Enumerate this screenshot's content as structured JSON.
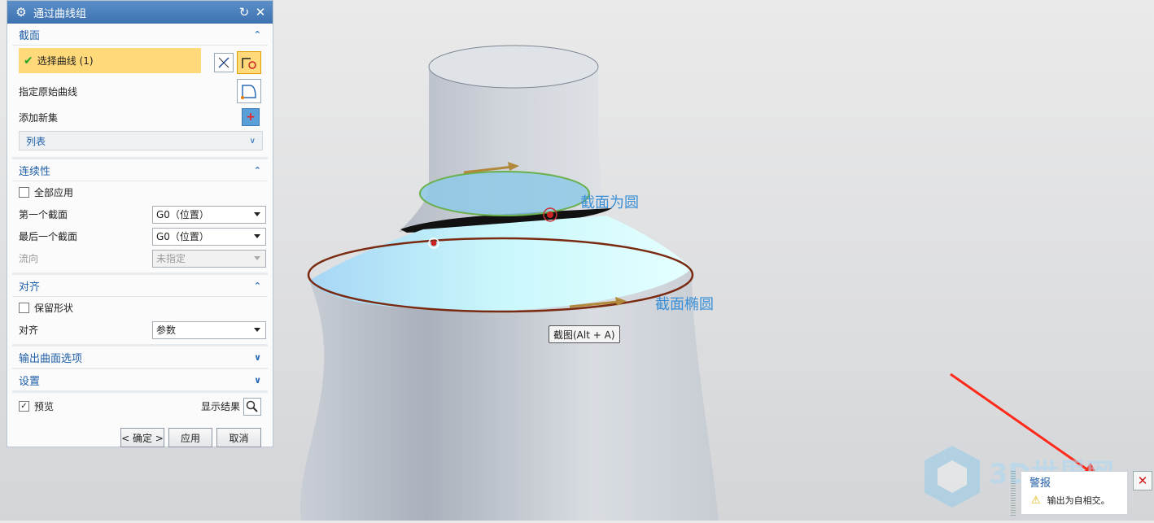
{
  "dialog": {
    "title": "通过曲线组",
    "sections": {
      "section": {
        "title": "截面",
        "select_curve": "选择曲线 (1)",
        "specify_origin": "指定原始曲线",
        "add_new_set": "添加新集",
        "list_label": "列表"
      },
      "continuity": {
        "title": "连续性",
        "apply_all": "全部应用",
        "first_section_label": "第一个截面",
        "first_section_value": "G0（位置）",
        "last_section_label": "最后一个截面",
        "last_section_value": "G0（位置）",
        "flow_label": "流向",
        "flow_value": "未指定"
      },
      "alignment": {
        "title": "对齐",
        "keep_shape": "保留形状",
        "align_label": "对齐",
        "align_value": "参数"
      },
      "output_options": {
        "title": "输出曲面选项"
      },
      "settings": {
        "title": "设置"
      }
    },
    "preview_label": "预览",
    "preview_checked": true,
    "show_result_label": "显示结果",
    "buttons": {
      "ok": "< 确定 >",
      "apply": "应用",
      "cancel": "取消"
    }
  },
  "viewport": {
    "annotation_circle": "截面为圆",
    "annotation_ellipse": "截面椭圆",
    "tooltip": "截图(Alt + A)",
    "watermark": "3D世界网"
  },
  "alert": {
    "title": "警报",
    "message": "输出为自相交。"
  },
  "colors": {
    "accent": "#1f5ea8",
    "titlebar": "#3f73b0",
    "selection": "#ffd97a",
    "annotation": "#3a8fd6",
    "ellipse_edge": "#7a2a10",
    "circle_edge": "#6ab04c",
    "alert_arrow": "#ff2a1a"
  },
  "icons": [
    "gear-icon",
    "reset-icon",
    "close-icon",
    "check-icon",
    "swap-direction-icon",
    "curve-pick-icon",
    "origin-curve-icon",
    "add-set-icon",
    "chevron-up-icon",
    "chevron-down-icon",
    "magnifier-icon",
    "warning-icon"
  ]
}
